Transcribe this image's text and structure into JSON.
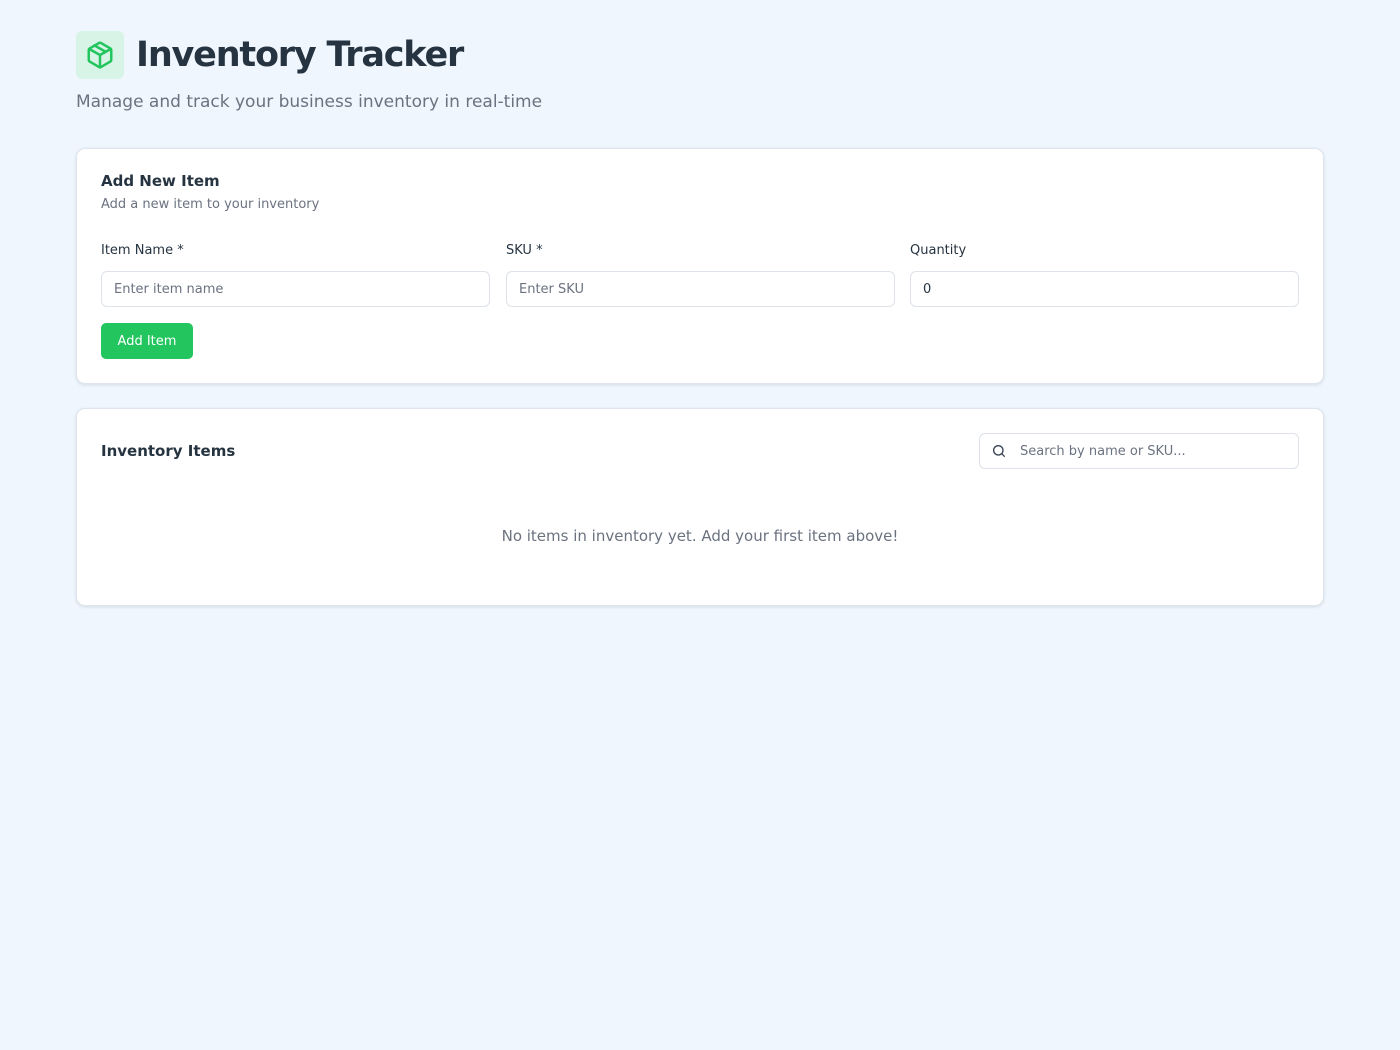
{
  "header": {
    "title": "Inventory Tracker",
    "subtitle": "Manage and track your business inventory in real-time",
    "logo_icon": "package-icon"
  },
  "add_form": {
    "title": "Add New Item",
    "description": "Add a new item to your inventory",
    "fields": [
      {
        "label": "Item Name *",
        "placeholder": "Enter item name",
        "value": ""
      },
      {
        "label": "SKU *",
        "placeholder": "Enter SKU",
        "value": ""
      },
      {
        "label": "Quantity",
        "placeholder": "",
        "value": "0"
      }
    ],
    "submit_label": "Add Item"
  },
  "inventory": {
    "title": "Inventory Items",
    "search": {
      "placeholder": "Search by name or SKU...",
      "value": "",
      "icon": "search-icon"
    },
    "empty_message": "No items in inventory yet. Add your first item above!",
    "items": []
  },
  "colors": {
    "page_background": "#eff6fd",
    "accent": "#22c55e",
    "logo_background": "#d7f4e6",
    "heading": "#263441",
    "muted_text": "#6b7280"
  }
}
